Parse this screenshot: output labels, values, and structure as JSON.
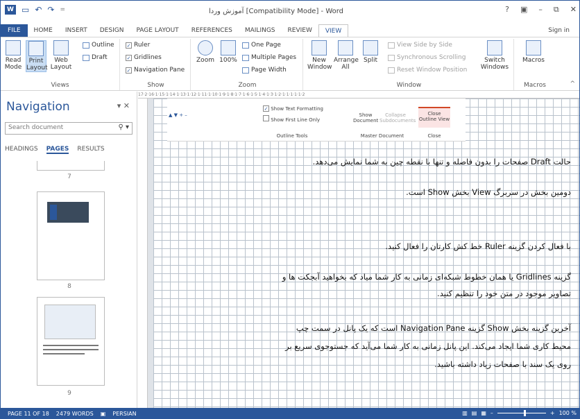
{
  "window": {
    "title": "آموزش وردا [Compatibility Mode] - Word",
    "controls": [
      "?",
      "▣",
      "–",
      "⧉",
      "✕"
    ]
  },
  "qat": {
    "app_icon": "W",
    "save": "💾",
    "undo": "↶",
    "redo": "↷"
  },
  "tabs": [
    "FILE",
    "HOME",
    "INSERT",
    "DESIGN",
    "PAGE LAYOUT",
    "REFERENCES",
    "MAILINGS",
    "REVIEW",
    "VIEW"
  ],
  "active_tab": "VIEW",
  "signin": "Sign in",
  "ribbon": {
    "views": {
      "label": "Views",
      "read_mode": "Read Mode",
      "print_layout": "Print Layout",
      "web_layout": "Web Layout",
      "outline": "Outline",
      "draft": "Draft"
    },
    "show": {
      "label": "Show",
      "ruler": "Ruler",
      "gridlines": "Gridlines",
      "navigation_pane": "Navigation Pane"
    },
    "zoom": {
      "label": "Zoom",
      "zoom": "Zoom",
      "hundred": "100%",
      "one_page": "One Page",
      "multiple_pages": "Multiple Pages",
      "page_width": "Page Width"
    },
    "window": {
      "label": "Window",
      "new_window": "New Window",
      "arrange_all": "Arrange All",
      "split": "Split",
      "view_side_by_side": "View Side by Side",
      "sync_scrolling": "Synchronous Scrolling",
      "reset_position": "Reset Window Position",
      "switch_windows": "Switch Windows"
    },
    "macros": {
      "label": "Macros",
      "macros": "Macros"
    }
  },
  "navigation": {
    "title": "Navigation",
    "search_placeholder": "Search document",
    "tabs": [
      "HEADINGS",
      "PAGES",
      "RESULTS"
    ],
    "active_tab": "PAGES",
    "page_numbers": [
      "7",
      "8",
      "9"
    ]
  },
  "ruler_text": "17·2·16·1·15·1·14·1·13·1·12·1·11·1·10·1·9·1·8·1·7·1·6·1·5·1·4·1·3·1·2·1·1·1·1·1·2",
  "embedded_ribbon": {
    "show_text_formatting": "Show Text Formatting",
    "show_first_line_only": "Show First Line Only",
    "outline_tools": "Outline Tools",
    "show_document": "Show Document",
    "collapse_subdocuments": "Collapse Subdocuments",
    "master_document": "Master Document",
    "close_outline_view": "Close Outline View",
    "close": "Close"
  },
  "document": {
    "p1": "حالت Draft صفحات را بدون فاصله و تنها با نقطه چین به شما نمایش می‌دهد.",
    "p2": "دومین بخش در سربرگ View بخش Show است.",
    "p3": "با فعال کردن گزینه Ruler خط کش کارتان را فعال کنید.",
    "p4a": "گزینه Gridlines یا همان خطوط شبکه‌ای زمانی به کار شما میاد که بخواهید آبجکت ها و",
    "p4b": "تصاویر موجود در متن خود را تنظیم کنید.",
    "p5a": "آخرین گزینه بخش Show گزینه Navigation Pane است که یک پانل در سمت چپ",
    "p5b": "محیط کاری شما ایجاد می‌کند. این پانل زمانی به کار شما می‌آید که جستوجوی سریع بر",
    "p5c": "روی یک سند با صفحات زیاد داشته باشید."
  },
  "status": {
    "page": "PAGE 11 OF 18",
    "words": "2479 WORDS",
    "language": "PERSIAN",
    "zoom": "100 %"
  }
}
